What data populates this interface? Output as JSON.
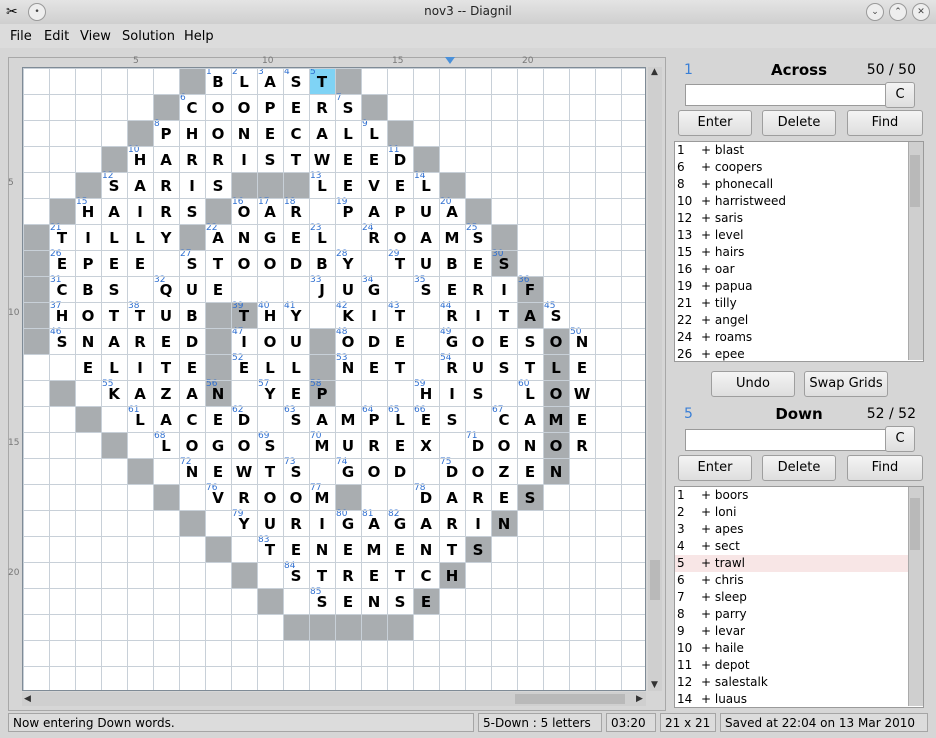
{
  "window": {
    "title": "nov3 -- Diagnil",
    "controls": [
      "chevron-down-icon",
      "chevron-up-icon",
      "close-icon"
    ]
  },
  "menu": [
    {
      "label": "File",
      "mnemonic": "F"
    },
    {
      "label": "Edit",
      "mnemonic": "E"
    },
    {
      "label": "View",
      "mnemonic": "V"
    },
    {
      "label": "Solution",
      "mnemonic": "S"
    },
    {
      "label": "Help",
      "mnemonic": "H"
    }
  ],
  "ruler": {
    "top": [
      "5",
      "10",
      "15",
      "20"
    ],
    "left": [
      "5",
      "10",
      "15",
      "20"
    ]
  },
  "grid": {
    "size": 21,
    "blocks": [
      [
        0,
        7
      ],
      [
        0,
        13
      ],
      [
        1,
        6
      ],
      [
        1,
        14
      ],
      [
        2,
        5
      ],
      [
        2,
        15
      ],
      [
        3,
        4
      ],
      [
        3,
        16
      ],
      [
        4,
        3
      ],
      [
        4,
        9
      ],
      [
        4,
        10
      ],
      [
        4,
        11
      ],
      [
        4,
        17
      ],
      [
        5,
        2
      ],
      [
        5,
        8
      ],
      [
        5,
        18
      ],
      [
        6,
        1
      ],
      [
        6,
        7
      ],
      [
        6,
        19
      ],
      [
        7,
        1
      ],
      [
        7,
        19
      ],
      [
        8,
        1
      ],
      [
        8,
        20
      ],
      [
        9,
        1
      ],
      [
        9,
        8
      ],
      [
        9,
        9
      ],
      [
        9,
        20
      ],
      [
        10,
        1
      ],
      [
        10,
        8
      ],
      [
        10,
        12
      ],
      [
        10,
        21
      ],
      [
        11,
        8
      ],
      [
        11,
        12
      ],
      [
        11,
        21
      ],
      [
        12,
        2
      ],
      [
        12,
        8
      ],
      [
        12,
        12
      ],
      [
        12,
        21
      ],
      [
        13,
        3
      ],
      [
        13,
        21
      ],
      [
        14,
        4
      ],
      [
        14,
        21
      ],
      [
        15,
        5
      ],
      [
        15,
        21
      ],
      [
        16,
        6
      ],
      [
        16,
        13
      ],
      [
        16,
        20
      ],
      [
        17,
        7
      ],
      [
        17,
        19
      ],
      [
        18,
        8
      ],
      [
        18,
        18
      ],
      [
        19,
        9
      ],
      [
        19,
        17
      ],
      [
        20,
        10
      ],
      [
        20,
        16
      ],
      [
        21,
        12
      ],
      [
        21,
        13
      ],
      [
        21,
        14
      ],
      [
        21,
        15
      ],
      [
        21,
        11
      ]
    ],
    "rows": [
      {
        "r": 0,
        "c": 8,
        "s": "BLAST"
      },
      {
        "r": 1,
        "c": 7,
        "s": "COOPERS"
      },
      {
        "r": 2,
        "c": 6,
        "s": "PHONECALL"
      },
      {
        "r": 3,
        "c": 5,
        "s": "HARRISTWEED"
      },
      {
        "r": 4,
        "c": 4,
        "s": "SARIS"
      },
      {
        "r": 4,
        "c": 12,
        "s": "LEVEL"
      },
      {
        "r": 5,
        "c": 3,
        "s": "HAIRS"
      },
      {
        "r": 5,
        "c": 9,
        "s": "OAR"
      },
      {
        "r": 5,
        "c": 13,
        "s": "PAPUA"
      },
      {
        "r": 6,
        "c": 2,
        "s": "TILLY"
      },
      {
        "r": 6,
        "c": 8,
        "s": "ANGEL"
      },
      {
        "r": 6,
        "c": 14,
        "s": "ROAMS"
      },
      {
        "r": 7,
        "c": 2,
        "s": "EPEE"
      },
      {
        "r": 7,
        "c": 7,
        "s": "STOODBY"
      },
      {
        "r": 7,
        "c": 15,
        "s": "TUBES"
      },
      {
        "r": 8,
        "c": 2,
        "s": "CBS"
      },
      {
        "r": 8,
        "c": 6,
        "s": "QUE"
      },
      {
        "r": 8,
        "c": 12,
        "s": "JUG"
      },
      {
        "r": 8,
        "c": 16,
        "s": "SERIF"
      },
      {
        "r": 9,
        "c": 2,
        "s": "HOTTUB"
      },
      {
        "r": 9,
        "c": 9,
        "s": "THY"
      },
      {
        "r": 9,
        "c": 13,
        "s": "KIT"
      },
      {
        "r": 9,
        "c": 17,
        "s": "RITAS"
      },
      {
        "r": 10,
        "c": 2,
        "s": "SNARED"
      },
      {
        "r": 10,
        "c": 9,
        "s": "IOU"
      },
      {
        "r": 10,
        "c": 13,
        "s": "ODE"
      },
      {
        "r": 10,
        "c": 17,
        "s": "GOESON"
      },
      {
        "r": 11,
        "c": 3,
        "s": "ELITE"
      },
      {
        "r": 11,
        "c": 9,
        "s": "ELL"
      },
      {
        "r": 11,
        "c": 13,
        "s": "NET"
      },
      {
        "r": 11,
        "c": 17,
        "s": "RUSTLE"
      },
      {
        "r": 12,
        "c": 4,
        "s": "KAZAN"
      },
      {
        "r": 12,
        "c": 10,
        "s": "YEP"
      },
      {
        "r": 12,
        "c": 16,
        "s": "HIS"
      },
      {
        "r": 12,
        "c": 20,
        "s": "LOW"
      },
      {
        "r": 13,
        "c": 5,
        "s": "LACED"
      },
      {
        "r": 13,
        "c": 11,
        "s": "SAMPLES"
      },
      {
        "r": 13,
        "c": 19,
        "s": "CAME"
      },
      {
        "r": 14,
        "c": 6,
        "s": "LOGOS"
      },
      {
        "r": 14,
        "c": 12,
        "s": "MUREX"
      },
      {
        "r": 14,
        "c": 18,
        "s": "DONOR"
      },
      {
        "r": 15,
        "c": 7,
        "s": "NEWTS"
      },
      {
        "r": 15,
        "c": 13,
        "s": "GOD"
      },
      {
        "r": 15,
        "c": 17,
        "s": "DOZEN"
      },
      {
        "r": 16,
        "c": 8,
        "s": "VROOM"
      },
      {
        "r": 16,
        "c": 16,
        "s": "DARES"
      },
      {
        "r": 17,
        "c": 9,
        "s": "YURIGAGARIN"
      },
      {
        "r": 18,
        "c": 10,
        "s": "TENEMENTS"
      },
      {
        "r": 19,
        "c": 11,
        "s": "STRETCH"
      },
      {
        "r": 20,
        "c": 12,
        "s": "SENSE"
      }
    ],
    "numbers": [
      [
        0,
        8,
        "1"
      ],
      [
        0,
        9,
        "2"
      ],
      [
        0,
        10,
        "3"
      ],
      [
        0,
        11,
        "4"
      ],
      [
        0,
        12,
        "5"
      ],
      [
        1,
        7,
        "6"
      ],
      [
        1,
        13,
        "7"
      ],
      [
        2,
        6,
        "8"
      ],
      [
        2,
        14,
        "9"
      ],
      [
        3,
        5,
        "10"
      ],
      [
        3,
        15,
        "11"
      ],
      [
        4,
        4,
        "12"
      ],
      [
        4,
        12,
        "13"
      ],
      [
        4,
        16,
        "14"
      ],
      [
        5,
        3,
        "15"
      ],
      [
        5,
        9,
        "16"
      ],
      [
        5,
        10,
        "17"
      ],
      [
        5,
        11,
        "18"
      ],
      [
        5,
        13,
        "19"
      ],
      [
        5,
        17,
        "20"
      ],
      [
        6,
        2,
        "21"
      ],
      [
        6,
        8,
        "22"
      ],
      [
        6,
        12,
        "23"
      ],
      [
        6,
        14,
        "24"
      ],
      [
        6,
        18,
        "25"
      ],
      [
        7,
        2,
        "26"
      ],
      [
        7,
        7,
        "27"
      ],
      [
        7,
        13,
        "28"
      ],
      [
        7,
        15,
        "29"
      ],
      [
        7,
        19,
        "30"
      ],
      [
        8,
        2,
        "31"
      ],
      [
        8,
        6,
        "32"
      ],
      [
        8,
        12,
        "33"
      ],
      [
        8,
        14,
        "34"
      ],
      [
        8,
        16,
        "35"
      ],
      [
        8,
        20,
        "36"
      ],
      [
        9,
        2,
        "37"
      ],
      [
        9,
        5,
        "38"
      ],
      [
        9,
        9,
        "39"
      ],
      [
        9,
        10,
        "40"
      ],
      [
        9,
        11,
        "41"
      ],
      [
        9,
        13,
        "42"
      ],
      [
        9,
        15,
        "43"
      ],
      [
        9,
        17,
        "44"
      ],
      [
        9,
        21,
        "45"
      ],
      [
        10,
        2,
        "46"
      ],
      [
        10,
        9,
        "47"
      ],
      [
        10,
        13,
        "48"
      ],
      [
        10,
        17,
        "49"
      ],
      [
        10,
        22,
        "50"
      ],
      [
        11,
        9,
        "52"
      ],
      [
        11,
        13,
        "53"
      ],
      [
        11,
        17,
        "54"
      ],
      [
        12,
        4,
        "55"
      ],
      [
        12,
        8,
        "56"
      ],
      [
        12,
        10,
        "57"
      ],
      [
        12,
        12,
        "58"
      ],
      [
        12,
        16,
        "59"
      ],
      [
        12,
        20,
        "60"
      ],
      [
        13,
        5,
        "61"
      ],
      [
        13,
        9,
        "62"
      ],
      [
        13,
        11,
        "63"
      ],
      [
        13,
        14,
        "64"
      ],
      [
        13,
        15,
        "65"
      ],
      [
        13,
        16,
        "66"
      ],
      [
        13,
        19,
        "67"
      ],
      [
        14,
        6,
        "68"
      ],
      [
        14,
        10,
        "69"
      ],
      [
        14,
        12,
        "70"
      ],
      [
        14,
        18,
        "71"
      ],
      [
        15,
        7,
        "72"
      ],
      [
        15,
        11,
        "73"
      ],
      [
        15,
        13,
        "74"
      ],
      [
        15,
        17,
        "75"
      ],
      [
        16,
        8,
        "76"
      ],
      [
        16,
        12,
        "77"
      ],
      [
        16,
        16,
        "78"
      ],
      [
        17,
        9,
        "79"
      ],
      [
        17,
        13,
        "80"
      ],
      [
        17,
        14,
        "81"
      ],
      [
        17,
        15,
        "82"
      ],
      [
        18,
        10,
        "83"
      ],
      [
        19,
        11,
        "84"
      ],
      [
        20,
        12,
        "85"
      ]
    ],
    "cursor": [
      0,
      12
    ]
  },
  "across": {
    "number": "1",
    "heading": "Across",
    "count": "50 / 50",
    "entry": "",
    "clear": "C",
    "enter": "Enter",
    "delete": "Delete",
    "find": "Find",
    "items": [
      [
        "1",
        "+ blast"
      ],
      [
        "6",
        "+ coopers"
      ],
      [
        "8",
        "+ phonecall"
      ],
      [
        "10",
        "+ harristweed"
      ],
      [
        "12",
        "+ saris"
      ],
      [
        "13",
        "+ level"
      ],
      [
        "15",
        "+ hairs"
      ],
      [
        "16",
        "+ oar"
      ],
      [
        "19",
        "+ papua"
      ],
      [
        "21",
        "+ tilly"
      ],
      [
        "22",
        "+ angel"
      ],
      [
        "24",
        "+ roams"
      ],
      [
        "26",
        "+ epee"
      ]
    ]
  },
  "middle": {
    "undo": "Undo",
    "swap": "Swap Grids"
  },
  "down": {
    "number": "5",
    "heading": "Down",
    "count": "52 / 52",
    "entry": "",
    "clear": "C",
    "enter": "Enter",
    "delete": "Delete",
    "find": "Find",
    "items": [
      [
        "1",
        "+ boors"
      ],
      [
        "2",
        "+ loni"
      ],
      [
        "3",
        "+ apes"
      ],
      [
        "4",
        "+ sect"
      ],
      [
        "5",
        "+ trawl"
      ],
      [
        "6",
        "+ chris"
      ],
      [
        "7",
        "+ sleep"
      ],
      [
        "8",
        "+ parry"
      ],
      [
        "9",
        "+ levar"
      ],
      [
        "10",
        "+ haile"
      ],
      [
        "11",
        "+ depot"
      ],
      [
        "12",
        "+ salestalk"
      ],
      [
        "14",
        "+ luaus"
      ]
    ],
    "selected_index": 4
  },
  "status": {
    "message": "Now entering Down words.",
    "word": "5-Down :  5 letters",
    "time": "03:20",
    "size": "21 x 21",
    "saved": "Saved at 22:04 on 13 Mar 2010"
  }
}
